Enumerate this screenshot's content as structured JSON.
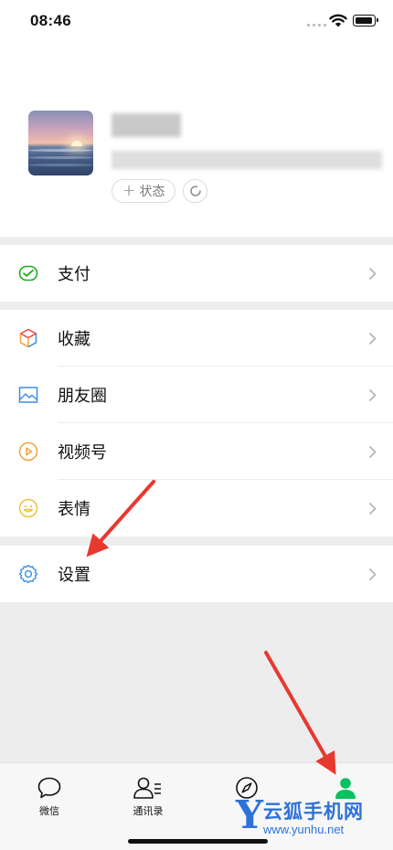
{
  "status_bar": {
    "time": "08:46"
  },
  "profile": {
    "status_button": "状态"
  },
  "menu": {
    "pay": "支付",
    "favorites": "收藏",
    "moments": "朋友圈",
    "channels": "视频号",
    "stickers": "表情",
    "settings": "设置"
  },
  "bottom_nav": [
    {
      "label": "微信",
      "active": false
    },
    {
      "label": "通讯录",
      "active": false
    },
    {
      "label": "发现",
      "active": false
    },
    {
      "label": "我",
      "active": true
    }
  ],
  "watermark": {
    "title": "云狐手机网",
    "url": "www.yunhu.net"
  },
  "colors": {
    "wechat_green": "#07c160",
    "annotation_red": "#e8392f",
    "watermark_blue": "#2d72d8",
    "background_gray": "#ededed"
  }
}
